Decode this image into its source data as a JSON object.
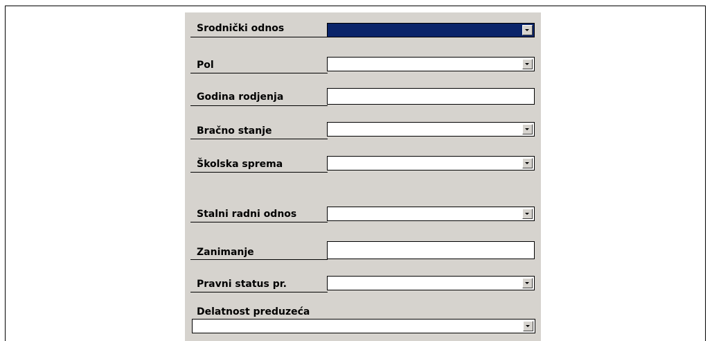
{
  "form": {
    "fields": [
      {
        "key": "srodnicki_odnos",
        "label": "Srodnički odnos",
        "value": "",
        "type": "dropdown",
        "selected": true
      },
      {
        "key": "pol",
        "label": "Pol",
        "value": "",
        "type": "dropdown"
      },
      {
        "key": "godina_rodjenja",
        "label": "Godina rodjenja",
        "value": "",
        "type": "text"
      },
      {
        "key": "bracno_stanje",
        "label": "Bračno stanje",
        "value": "",
        "type": "dropdown"
      },
      {
        "key": "skolska_sprema",
        "label": "Školska sprema",
        "value": "",
        "type": "dropdown"
      },
      {
        "key": "stalni_radni_odnos",
        "label": "Stalni radni odnos",
        "value": "",
        "type": "dropdown"
      },
      {
        "key": "zanimanje",
        "label": "Zanimanje",
        "value": "",
        "type": "text"
      },
      {
        "key": "pravni_status",
        "label": "Pravni status pr.",
        "value": "",
        "type": "dropdown"
      },
      {
        "key": "delatnost_preduzeca",
        "label": "Delatnost preduzeća",
        "value": "",
        "type": "dropdown"
      }
    ]
  },
  "colors": {
    "panel_bg": "#d6d3ce",
    "selection": "#0a246a"
  },
  "icons": {
    "dropdown": "chevron-down-icon"
  }
}
